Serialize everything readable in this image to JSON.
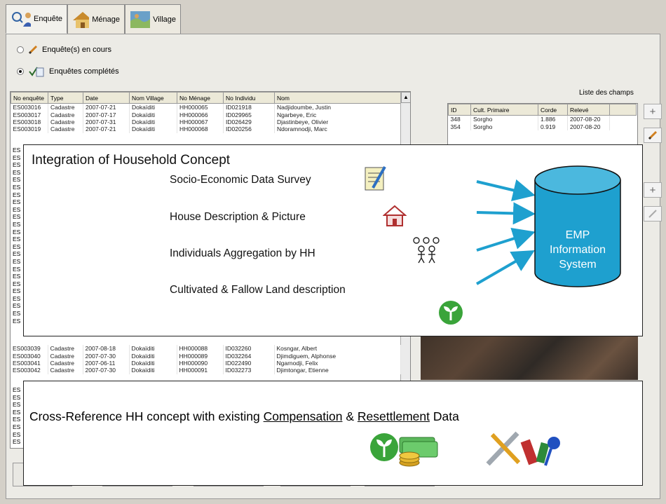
{
  "tabs": [
    {
      "label": "Enquête"
    },
    {
      "label": "Ménage"
    },
    {
      "label": "Village"
    }
  ],
  "filters": [
    {
      "label": "Enquête(s) en cours",
      "selected": false
    },
    {
      "label": "Enquêtes complétés",
      "selected": true
    }
  ],
  "survey_table": {
    "columns": [
      "No enquête",
      "Type",
      "Date",
      "Nom Village",
      "No Ménage",
      "No Individu",
      "Nom"
    ],
    "top_rows": [
      [
        "ES003016",
        "Cadastre",
        "2007-07-21",
        "Dokaïditi",
        "HH000065",
        "ID021918",
        "Nadjidoumbe, Justin"
      ],
      [
        "ES003017",
        "Cadastre",
        "2007-07-17",
        "Dokaïditi",
        "HH000066",
        "ID029965",
        "Ngarbeye, Eric"
      ],
      [
        "ES003018",
        "Cadastre",
        "2007-07-31",
        "Dokaïditi",
        "HH000067",
        "ID026429",
        "Djastinbeye, Olivier"
      ],
      [
        "ES003019",
        "Cadastre",
        "2007-07-21",
        "Dokaïditi",
        "HH000068",
        "ID020256",
        "Ndoramnodji, Marc"
      ]
    ],
    "bottom_rows": [
      [
        "ES003039",
        "Cadastre",
        "2007-08-18",
        "Dokaïditi",
        "HH000088",
        "ID032260",
        "Kosngar, Albert"
      ],
      [
        "ES003040",
        "Cadastre",
        "2007-07-30",
        "Dokaïditi",
        "HH000089",
        "ID032264",
        "Djimdiguem, Alphonse"
      ],
      [
        "ES003041",
        "Cadastre",
        "2007-06-11",
        "Dokaïditi",
        "HH000090",
        "ID022490",
        "Ngarnodji, Felix"
      ],
      [
        "ES003042",
        "Cadastre",
        "2007-07-30",
        "Dokaïditi",
        "HH000091",
        "ID032273",
        "Djimtongar, Etienne"
      ]
    ],
    "left_stubs": [
      "ES",
      "ES",
      "ES",
      "ES",
      "ES",
      "ES",
      "ES",
      "ES",
      "ES",
      "ES",
      "ES",
      "ES",
      "ES",
      "ES",
      "ES",
      "ES",
      "ES",
      "ES",
      "ES",
      "ES",
      "ES",
      "ES",
      "ES",
      "ES"
    ],
    "lower_stubs": [
      "ES",
      "ES",
      "ES",
      "ES",
      "ES",
      "ES",
      "ES",
      "ES"
    ]
  },
  "fields_panel": {
    "title": "Liste des champs",
    "columns": [
      "ID",
      "Cult. Primaire",
      "Corde",
      "Relevé"
    ],
    "rows": [
      [
        "348",
        "Sorgho",
        "1.886",
        "2007-08-20"
      ],
      [
        "354",
        "Sorgho",
        "0.919",
        "2007-08-20"
      ]
    ]
  },
  "overlay_household": {
    "title": "Integration of Household Concept",
    "bullets": [
      "Socio-Economic Data Survey",
      "House  Description  &  Picture",
      "Individuals Aggregation by HH",
      "Cultivated & Fallow Land description"
    ],
    "database_label_1": "EMP",
    "database_label_2": "Information",
    "database_label_3": "System"
  },
  "overlay_crossref": {
    "text_1": "Cross-Reference HH concept with existing ",
    "link_1": "Compensation",
    "text_2": " & ",
    "link_2": "Resettlement",
    "text_3": " Data"
  },
  "colors": {
    "accent": "#1ea0cf",
    "db_fill": "#1ea0cf",
    "green": "#3aa43a"
  }
}
